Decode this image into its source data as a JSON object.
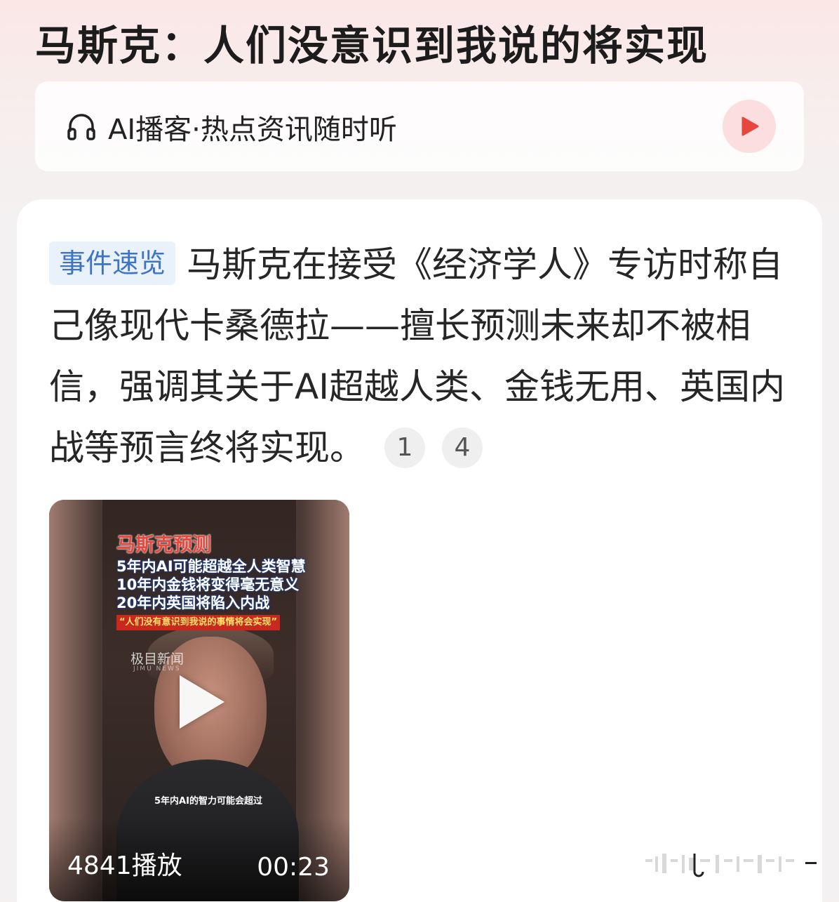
{
  "header": {
    "title": "马斯克：人们没意识到我说的将实现"
  },
  "podcast": {
    "icon": "headphones-icon",
    "label": "AI播客·热点资讯随时听",
    "play_icon": "play-icon",
    "accent_color": "#e8453c"
  },
  "summary": {
    "tag": "事件速览",
    "text": "马斯克在接受《经济学人》专访时称自己像现代卡桑德拉——擅长预测未来却不被相信，强调其关于AI超越人类、金钱无用、英国内战等预言终将实现。",
    "refs": [
      "1",
      "4"
    ],
    "tag_color": "#3f74c4"
  },
  "video": {
    "overlay_title": "马斯克预测",
    "overlay_lines": [
      "5年内AI可能超越全人类智慧",
      "10年内金钱将变得毫无意义",
      "20年内英国将陷入内战"
    ],
    "overlay_quote": "“人们没有意识到我说的事情将会实现”",
    "watermark": "极目新闻",
    "watermark_sub": "JIMU NEWS",
    "subtitle": "5年内AI的智力可能会超过",
    "play_count": "4841播放",
    "duration": "00:23"
  }
}
